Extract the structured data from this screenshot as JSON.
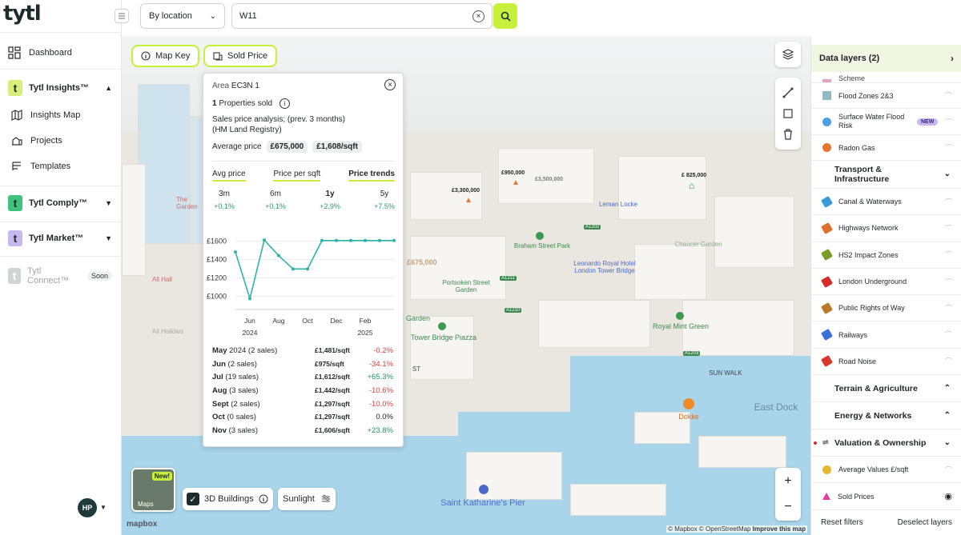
{
  "app": {
    "logo": "tytl"
  },
  "sidebar": {
    "dashboard": "Dashboard",
    "insights": {
      "label": "Tytl Insights™",
      "badge": "t"
    },
    "insights_items": [
      "Insights Map",
      "Projects",
      "Templates"
    ],
    "comply": {
      "label": "Tytl Comply™",
      "badge": "t"
    },
    "market": {
      "label": "Tytl Market™",
      "badge": "t"
    },
    "connect": {
      "label": "Tytl Connect™",
      "badge": "t",
      "tag": "Soon"
    },
    "avatar": "HP"
  },
  "topbar": {
    "search_mode": "By location",
    "search_value": "W11"
  },
  "map": {
    "map_key": "Map Key",
    "sold_price": "Sold Price",
    "maps_tile": {
      "badge": "New!",
      "label": "Maps"
    },
    "buildings_3d": "3D Buildings",
    "sunlight": "Sunlight",
    "attribution": "© Mapbox © OpenStreetMap",
    "improve": "Improve this map",
    "mapbox": "mapbox",
    "labels": {
      "braham": "Braham Street Park",
      "leonardo": "Leonardo Royal Hotel London Tower Bridge",
      "leman": "Leman Locke",
      "portsoken": "Portsoken Street Garden",
      "towerbridge": "Tower Bridge Piazza",
      "royalmint": "Royal Mint Green",
      "chaucer": "Chaucer Garden",
      "sunwalk": "SUN WALK",
      "eastdock": "East Dock",
      "dokke": "Dokke",
      "stkath": "Saint Katharine's Pier",
      "garden": "Garden",
      "allhallows": "All Hallows",
      "thegarden": "The Garden",
      "allhall": "All Hall",
      "st": "ST"
    },
    "prices": {
      "p1": "£950,000",
      "p2": "£3,500,000",
      "p3": "£3,300,000",
      "p4": "£ 825,000",
      "p5": "£675,000"
    },
    "roads": [
      "A1211",
      "A1202",
      "A1210",
      "A1203"
    ]
  },
  "popup": {
    "area_label": "Area",
    "area_value": "EC3N 1",
    "sold_count": "1",
    "sold_label": "Properties sold",
    "analysis": "Sales price analysis; (prev. 3 months)",
    "source": "(HM Land Registry)",
    "avg_label": "Average price",
    "avg_price": "£675,000",
    "avg_sqft": "£1,608/sqft",
    "tabs": [
      "Avg price",
      "Price per sqft",
      "Price trends"
    ],
    "periods": [
      {
        "label": "3m",
        "change": "+0.1%"
      },
      {
        "label": "6m",
        "change": "+0.1%"
      },
      {
        "label": "1y",
        "change": "+2.9%"
      },
      {
        "label": "5y",
        "change": "+7.5%"
      }
    ],
    "sales": [
      {
        "month": "May",
        "year": "2024",
        "count": "(2 sales)",
        "price": "£1,481/sqft",
        "change": "-0.2%",
        "dir": "neg"
      },
      {
        "month": "Jun",
        "year": "",
        "count": "(2 sales)",
        "price": "£975/sqft",
        "change": "-34.1%",
        "dir": "neg"
      },
      {
        "month": "Jul",
        "year": "",
        "count": "(19 sales)",
        "price": "£1,612/sqft",
        "change": "+65.3%",
        "dir": "pos"
      },
      {
        "month": "Aug",
        "year": "",
        "count": "(3 sales)",
        "price": "£1,442/sqft",
        "change": "-10.6%",
        "dir": "neg"
      },
      {
        "month": "Sept",
        "year": "",
        "count": "(2 sales)",
        "price": "£1,297/sqft",
        "change": "-10.0%",
        "dir": "neg"
      },
      {
        "month": "Oct",
        "year": "",
        "count": "(0 sales)",
        "price": "£1,297/sqft",
        "change": "0.0%",
        "dir": "neu"
      },
      {
        "month": "Nov",
        "year": "",
        "count": "(3 sales)",
        "price": "£1,606/sqft",
        "change": "+23.8%",
        "dir": "pos"
      }
    ]
  },
  "chart_data": {
    "type": "line",
    "x": [
      "2024-05",
      "2024-06",
      "2024-07",
      "2024-08",
      "2024-09",
      "2024-10",
      "2024-11",
      "2024-12",
      "2025-01",
      "2025-02",
      "2025-03",
      "2025-04"
    ],
    "series": [
      {
        "values": [
          1481,
          975,
          1612,
          1442,
          1297,
          1297,
          1606,
          1606,
          1606,
          1606,
          1606,
          1606
        ]
      }
    ],
    "y_ticks": [
      "£1600",
      "£1400",
      "£1200",
      "£1000"
    ],
    "x_ticks": [
      {
        "label": "Jun",
        "sub": "2024"
      },
      {
        "label": "Aug",
        "sub": ""
      },
      {
        "label": "Oct",
        "sub": ""
      },
      {
        "label": "Dec",
        "sub": ""
      },
      {
        "label": "Feb",
        "sub": "2025"
      }
    ],
    "ylim": [
      900,
      1700
    ],
    "color": "#2bb3a8",
    "grid": true
  },
  "layers": {
    "title": "Data layers (2)",
    "items_top": [
      {
        "label": "Scheme",
        "color": "#e7a0c8"
      },
      {
        "label": "Flood Zones 2&3",
        "color": "#8fb8c8"
      },
      {
        "label": "Surface Water Flood Risk",
        "color": "#4aa0e0",
        "badge": "NEW"
      },
      {
        "label": "Radon Gas",
        "color": "#e8762c"
      }
    ],
    "transport": "Transport & Infrastructure",
    "transport_items": [
      {
        "label": "Canal & Waterways",
        "color": "#3a9ad9"
      },
      {
        "label": "Highways Network",
        "color": "#e0702c"
      },
      {
        "label": "HS2 Impact Zones",
        "color": "#7a9a2a"
      },
      {
        "label": "London Underground",
        "color": "#d52b2b"
      },
      {
        "label": "Public Rights of Way",
        "color": "#b77a2a"
      },
      {
        "label": "Railways",
        "color": "#3b6fd9"
      },
      {
        "label": "Road Noise",
        "color": "#d8382c"
      }
    ],
    "terrain": "Terrain & Agriculture",
    "energy": "Energy & Networks",
    "valuation": "Valuation & Ownership",
    "valuation_items": [
      {
        "label": "Average Values £/sqft",
        "color": "#e8b82c"
      },
      {
        "label": "Sold Prices",
        "color": "#e23ba0"
      }
    ],
    "reset": "Reset filters",
    "deselect": "Deselect layers"
  },
  "colors": {
    "accent": "#c7f03a",
    "teal": "#2bb3a8",
    "brand_dark": "#1c2b2b"
  }
}
